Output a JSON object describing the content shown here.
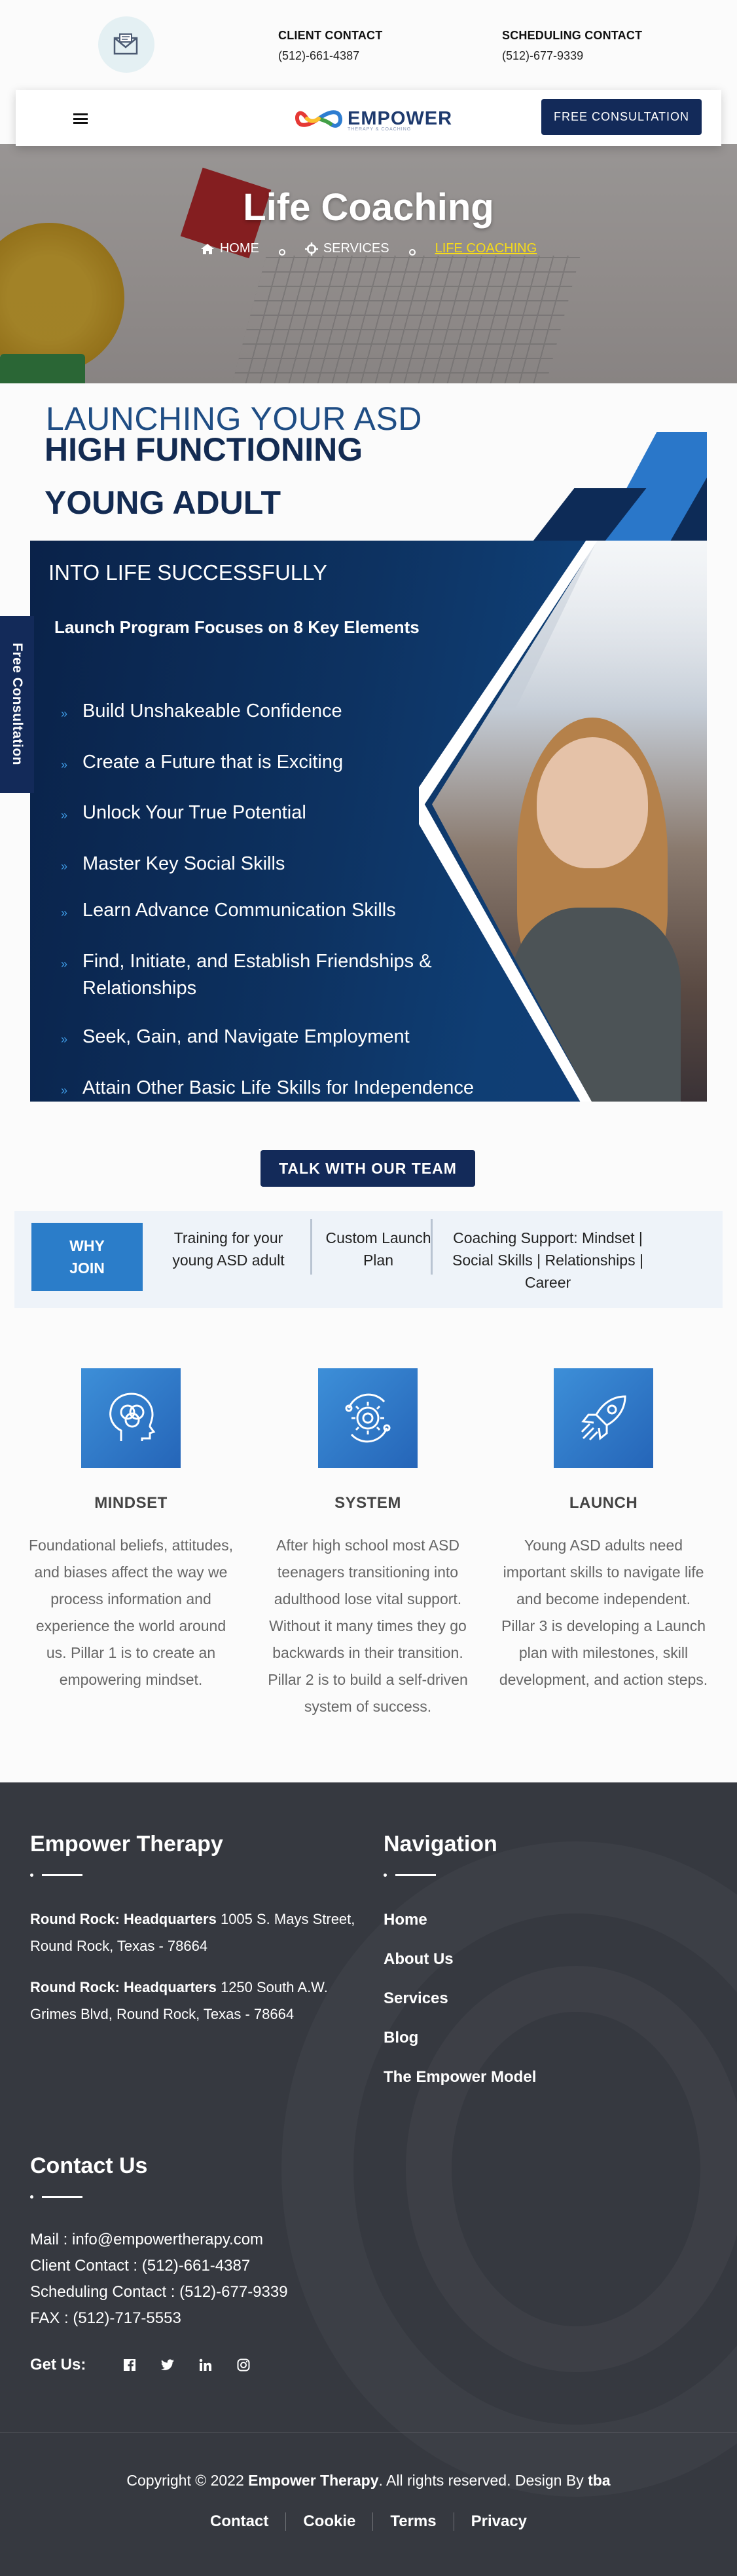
{
  "topbar": {
    "client": {
      "title": "CLIENT CONTACT",
      "phone": "(512)-661-4387"
    },
    "scheduling": {
      "title": "SCHEDULING CONTACT",
      "phone": "(512)-677-9339"
    }
  },
  "nav": {
    "logo_text": "EMPOWER",
    "logo_tagline": "THERAPY & COACHING",
    "cta": "FREE CONSULTATION"
  },
  "hero": {
    "title": "Life Coaching",
    "breadcrumb": [
      "HOME",
      "SERVICES",
      "LIFE COACHING"
    ]
  },
  "launch": {
    "pre": "LAUNCHING YOUR ASD",
    "h1": "HIGH FUNCTIONING",
    "h2": "YOUNG ADULT",
    "panel_pre": "INTO LIFE SUCCESSFULLY",
    "panel_sub": "Launch Program Focuses on 8 Key Elements",
    "features": [
      "Build Unshakeable Confidence",
      "Create a Future that is Exciting",
      "Unlock Your True Potential",
      "Master Key Social Skills",
      "Learn Advance Communication Skills",
      "Find, Initiate, and Establish Friendships & Relationships",
      "Seek, Gain, and Navigate Employment",
      "Attain Other Basic Life Skills for Independence"
    ]
  },
  "side_tab": "Free Consultation",
  "talk_button": "TALK WITH OUR TEAM",
  "why": {
    "label": "WHY JOIN",
    "items": [
      "Training for your young ASD adult",
      "Custom Launch Plan",
      "Coaching Support: Mindset | Social Skills | Relationships | Career"
    ]
  },
  "pillars": [
    {
      "icon": "brain-icon",
      "title": "MINDSET",
      "body": "Foundational beliefs, attitudes, and biases affect the way we process information and experience the world around us. Pillar 1 is to create an empowering mindset."
    },
    {
      "icon": "gear-icon",
      "title": "SYSTEM",
      "body": "After high school most ASD teenagers transitioning into adulthood lose vital support. Without it many times they go backwards in their transition. Pillar 2 is to build a self-driven system of success."
    },
    {
      "icon": "rocket-icon",
      "title": "LAUNCH",
      "body": "Young ASD adults need important skills to navigate life and become independent. Pillar 3 is developing a Launch plan with milestones, skill development, and action steps."
    }
  ],
  "footer": {
    "brand_heading": "Empower Therapy",
    "addresses": [
      {
        "label": "Round Rock: Headquarters",
        "text": "1005 S. Mays Street, Round Rock, Texas - 78664"
      },
      {
        "label": "Round Rock: Headquarters",
        "text": "1250 South A.W. Grimes Blvd, Round Rock, Texas - 78664"
      }
    ],
    "nav_heading": "Navigation",
    "nav_links": [
      "Home",
      "About Us",
      "Services",
      "Blog",
      "The Empower Model"
    ],
    "contact_heading": "Contact Us",
    "contact_lines": [
      "Mail : info@empowertherapy.com",
      "Client Contact : (512)-661-4387",
      "Scheduling Contact : (512)-677-9339",
      "FAX : (512)-717-5553"
    ],
    "get_us": "Get Us:",
    "copyright_prefix": "Copyright © 2022",
    "copyright_brand": "Empower Therapy",
    "copyright_mid": ". All rights reserved. Design By",
    "copyright_designer": "tba",
    "legal": [
      "Contact",
      "Cookie",
      "Terms",
      "Privacy"
    ]
  },
  "colors": {
    "navy": "#132a59",
    "blue": "#2b7dc9",
    "heading_blue": "#1f4d84",
    "footer_bg": "#363940",
    "breadcrumb_active": "#f7dc18"
  }
}
